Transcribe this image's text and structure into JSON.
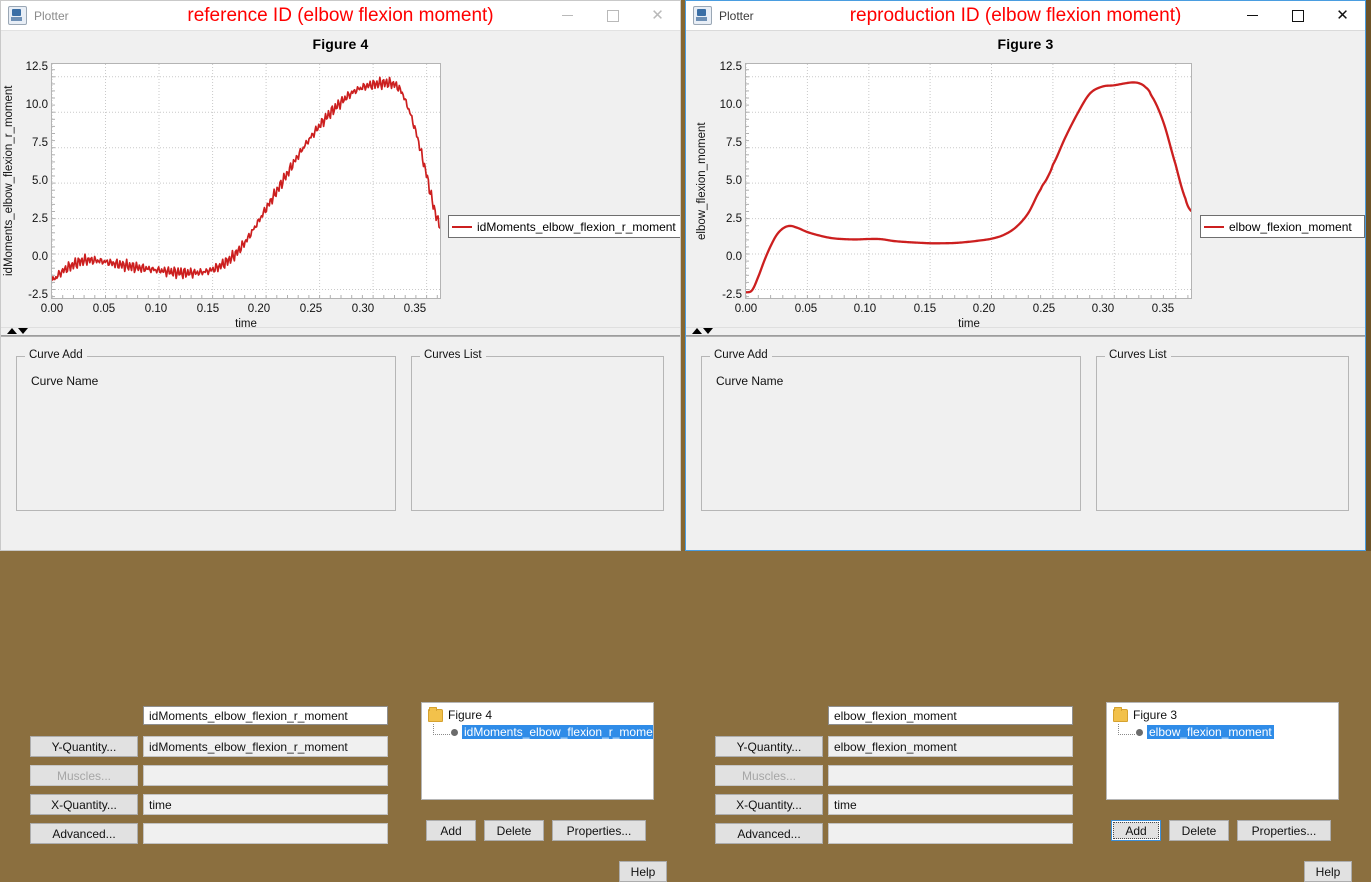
{
  "windows": [
    {
      "app_name": "Plotter",
      "title": "reference ID (elbow flexion moment)",
      "active": false,
      "figure_title": "Figure 4",
      "legend_label": "idMoments_elbow_flexion_r_moment",
      "curve_add": {
        "group_title": "Curve Add",
        "curve_name_label": "Curve Name",
        "curve_name_value": "idMoments_elbow_flexion_r_moment",
        "y_quantity_button": "Y-Quantity...",
        "y_quantity_value": "idMoments_elbow_flexion_r_moment",
        "muscles_button": "Muscles...",
        "muscles_value": "",
        "x_quantity_button": "X-Quantity...",
        "x_quantity_value": "time",
        "advanced_button": "Advanced...",
        "advanced_value": ""
      },
      "curves_list": {
        "group_title": "Curves List",
        "root": "Figure 4",
        "child": "idMoments_elbow_flexion_r_moment",
        "add_button": "Add",
        "delete_button": "Delete",
        "properties_button": "Properties...",
        "add_focused": false
      },
      "help_button": "Help"
    },
    {
      "app_name": "Plotter",
      "title": "reproduction ID (elbow flexion moment)",
      "active": true,
      "figure_title": "Figure 3",
      "legend_label": "elbow_flexion_moment",
      "curve_add": {
        "group_title": "Curve Add",
        "curve_name_label": "Curve Name",
        "curve_name_value": "elbow_flexion_moment",
        "y_quantity_button": "Y-Quantity...",
        "y_quantity_value": "elbow_flexion_moment",
        "muscles_button": "Muscles...",
        "muscles_value": "",
        "x_quantity_button": "X-Quantity...",
        "x_quantity_value": "time",
        "advanced_button": "Advanced...",
        "advanced_value": ""
      },
      "curves_list": {
        "group_title": "Curves List",
        "root": "Figure 3",
        "child": "elbow_flexion_moment",
        "add_button": "Add",
        "delete_button": "Delete",
        "properties_button": "Properties...",
        "add_focused": true
      },
      "help_button": "Help"
    }
  ],
  "titlebar_controls": {
    "minimize": "minimize-icon",
    "maximize": "maximize-icon",
    "close": "close-icon"
  },
  "colors": {
    "curve": "#cc1f1f",
    "title_text": "#ff0000",
    "selection": "#2f8ce8",
    "active_window_border": "#4a9de0"
  },
  "chart_data": [
    {
      "type": "line",
      "title": "Figure 4",
      "xlabel": "time",
      "ylabel": "idMoments_elbow_flexion_r_moment",
      "xlim": [
        0.0,
        0.3625
      ],
      "ylim": [
        -3.1,
        13.4
      ],
      "xticks": [
        "0.00",
        "0.05",
        "0.10",
        "0.15",
        "0.20",
        "0.25",
        "0.30",
        "0.35"
      ],
      "xtick_values": [
        0.0,
        0.05,
        0.1,
        0.15,
        0.2,
        0.25,
        0.3,
        0.35
      ],
      "yticks": [
        "-2.5",
        "0.0",
        "2.5",
        "5.0",
        "7.5",
        "10.0",
        "12.5"
      ],
      "ytick_values": [
        -2.5,
        0.0,
        2.5,
        5.0,
        7.5,
        10.0,
        12.5
      ],
      "grid": true,
      "legend_position": "right-outside",
      "noise": 0.33,
      "series": [
        {
          "name": "idMoments_elbow_flexion_r_moment",
          "color": "#cc1f1f",
          "x": [
            0.0,
            0.01,
            0.02,
            0.03,
            0.04,
            0.05,
            0.06,
            0.07,
            0.08,
            0.09,
            0.1,
            0.11,
            0.12,
            0.13,
            0.14,
            0.15,
            0.16,
            0.17,
            0.18,
            0.19,
            0.2,
            0.21,
            0.22,
            0.23,
            0.24,
            0.25,
            0.26,
            0.27,
            0.28,
            0.29,
            0.3,
            0.31,
            0.315,
            0.32,
            0.325,
            0.33,
            0.34,
            0.35,
            0.358,
            0.3625
          ],
          "y": [
            -1.85,
            -1.2,
            -0.75,
            -0.45,
            -0.45,
            -0.55,
            -0.7,
            -0.82,
            -0.95,
            -1.05,
            -1.15,
            -1.25,
            -1.32,
            -1.33,
            -1.28,
            -1.1,
            -0.7,
            -0.1,
            0.8,
            1.95,
            3.2,
            4.45,
            5.7,
            6.95,
            8.05,
            9.05,
            9.95,
            10.7,
            11.35,
            11.75,
            11.95,
            12.05,
            12.05,
            11.95,
            11.6,
            10.8,
            8.6,
            5.6,
            3.0,
            2.1
          ]
        }
      ]
    },
    {
      "type": "line",
      "title": "Figure 3",
      "xlabel": "time",
      "ylabel": "elbow_flexion_moment",
      "xlim": [
        0.0,
        0.3625
      ],
      "ylim": [
        -3.1,
        13.4
      ],
      "xticks": [
        "0.00",
        "0.05",
        "0.10",
        "0.15",
        "0.20",
        "0.25",
        "0.30",
        "0.35"
      ],
      "xtick_values": [
        0.0,
        0.05,
        0.1,
        0.15,
        0.2,
        0.25,
        0.3,
        0.35
      ],
      "yticks": [
        "-2.5",
        "0.0",
        "2.5",
        "5.0",
        "7.5",
        "10.0",
        "12.5"
      ],
      "ytick_values": [
        -2.5,
        0.0,
        2.5,
        5.0,
        7.5,
        10.0,
        12.5
      ],
      "grid": true,
      "legend_position": "right-outside",
      "noise": 0.0,
      "series": [
        {
          "name": "elbow_flexion_moment",
          "color": "#cc1f1f",
          "x": [
            0.0,
            0.005,
            0.01,
            0.015,
            0.02,
            0.025,
            0.03,
            0.035,
            0.04,
            0.05,
            0.06,
            0.07,
            0.08,
            0.09,
            0.1,
            0.11,
            0.12,
            0.13,
            0.14,
            0.15,
            0.16,
            0.17,
            0.18,
            0.19,
            0.2,
            0.21,
            0.22,
            0.23,
            0.24,
            0.245,
            0.25,
            0.26,
            0.27,
            0.28,
            0.29,
            0.3,
            0.31,
            0.315,
            0.32,
            0.325,
            0.33,
            0.34,
            0.35,
            0.358,
            0.3625
          ],
          "y": [
            -2.7,
            -2.55,
            -1.6,
            -0.45,
            0.55,
            1.35,
            1.8,
            1.98,
            1.9,
            1.55,
            1.3,
            1.12,
            1.05,
            1.03,
            1.06,
            1.05,
            0.92,
            0.85,
            0.8,
            0.76,
            0.76,
            0.78,
            0.85,
            0.95,
            1.08,
            1.35,
            1.9,
            2.9,
            4.55,
            5.3,
            6.3,
            8.2,
            9.9,
            11.3,
            11.8,
            11.9,
            12.05,
            12.1,
            12.05,
            11.8,
            11.2,
            9.3,
            6.3,
            3.9,
            3.05
          ]
        }
      ]
    }
  ]
}
